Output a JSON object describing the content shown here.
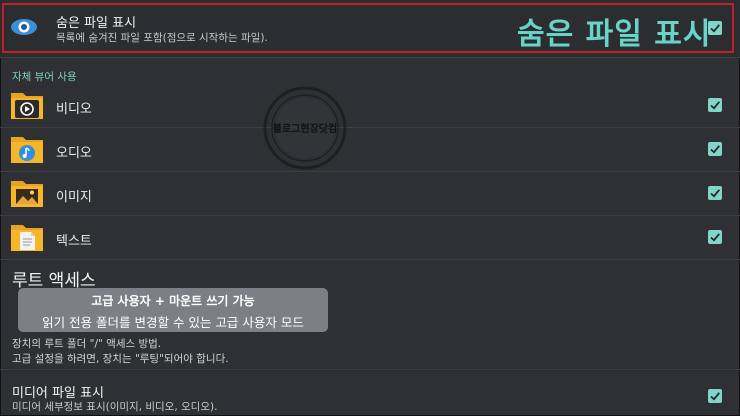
{
  "hidden_files": {
    "title": "숨은 파일 표시",
    "subtitle": "목록에 숨겨진 파일 포함(점으로 시작하는 파일).",
    "caption": "숨은 파일 표시",
    "checked": true
  },
  "builtin_viewer": {
    "section_label": "자체 뷰어 사용",
    "items": [
      {
        "label": "비디오",
        "icon": "video-folder-icon",
        "checked": true
      },
      {
        "label": "오디오",
        "icon": "audio-folder-icon",
        "checked": true
      },
      {
        "label": "이미지",
        "icon": "image-folder-icon",
        "checked": true
      },
      {
        "label": "텍스트",
        "icon": "text-folder-icon",
        "checked": true
      }
    ]
  },
  "root_access": {
    "title": "루트 액세스",
    "toast_line1": "고급 사용자 + 마운트 쓰기 가능",
    "toast_line2": "읽기 전용 폴더를 변경할 수 있는 고급 사용자 모드",
    "desc_line1": "장치의 루트 폴더 \"/\" 액세스 방법.",
    "desc_line2": "고급 설정을 하려면, 장치는 \"루팅\"되어야 합니다."
  },
  "media_files": {
    "title": "미디어 파일 표시",
    "subtitle": "미디어 세부정보 표시(이미지, 비디오, 오디오).",
    "checked": true
  },
  "watermark": {
    "text": "블로그현장닷컴"
  },
  "colors": {
    "accent": "#82d3c8",
    "highlight_border": "#c2202a",
    "background": "#2e3033"
  }
}
